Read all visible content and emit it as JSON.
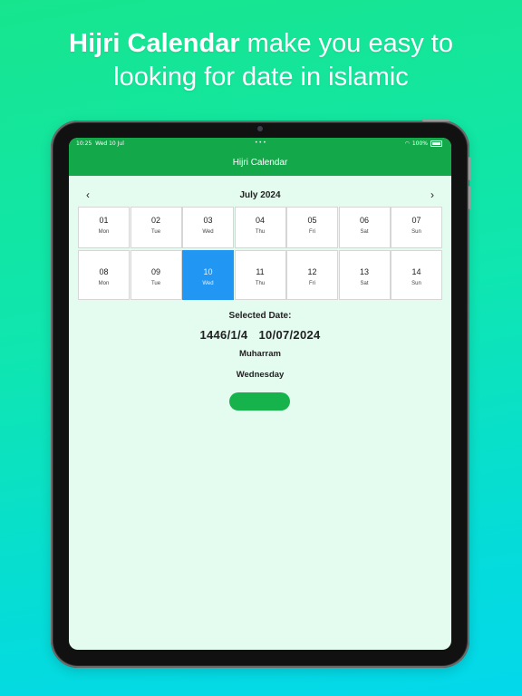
{
  "headline": {
    "bold": "Hijri Calendar",
    "rest_line1": " make you easy to",
    "line2": "looking for date in islamic"
  },
  "status_bar": {
    "time": "10:25",
    "date": "Wed 10 Jul",
    "dots": "•••",
    "wifi": "wifi",
    "battery": "100%"
  },
  "app": {
    "title": "Hijri Calendar",
    "accent_color": "#13a84a",
    "selected_color": "#2196f3"
  },
  "calendar": {
    "month_label": "July 2024",
    "prev_icon": "‹",
    "next_icon": "›",
    "days": [
      {
        "num": "01",
        "wd": "Mon"
      },
      {
        "num": "02",
        "wd": "Tue"
      },
      {
        "num": "03",
        "wd": "Wed"
      },
      {
        "num": "04",
        "wd": "Thu"
      },
      {
        "num": "05",
        "wd": "Fri"
      },
      {
        "num": "06",
        "wd": "Sat"
      },
      {
        "num": "07",
        "wd": "Sun"
      },
      {
        "num": "08",
        "wd": "Mon"
      },
      {
        "num": "09",
        "wd": "Tue"
      },
      {
        "num": "10",
        "wd": "Wed",
        "selected": true
      },
      {
        "num": "11",
        "wd": "Thu"
      },
      {
        "num": "12",
        "wd": "Fri"
      },
      {
        "num": "13",
        "wd": "Sat"
      },
      {
        "num": "14",
        "wd": "Sun"
      }
    ]
  },
  "selection": {
    "title": "Selected Date:",
    "hijri": "1446/1/4",
    "gregorian": "10/07/2024",
    "hijri_month": "Muharram",
    "weekday": "Wednesday"
  },
  "action_button": {
    "label": ""
  }
}
